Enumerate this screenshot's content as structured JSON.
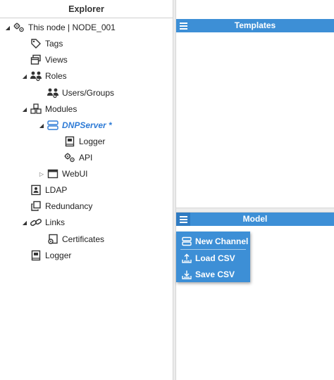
{
  "explorer": {
    "title": "Explorer",
    "nodes": [
      {
        "label": "This node | NODE_001"
      },
      {
        "label": "Tags"
      },
      {
        "label": "Views"
      },
      {
        "label": "Roles"
      },
      {
        "label": "Users/Groups"
      },
      {
        "label": "Modules"
      },
      {
        "label": "DNPServer *"
      },
      {
        "label": "Logger"
      },
      {
        "label": "API"
      },
      {
        "label": "WebUI"
      },
      {
        "label": "LDAP"
      },
      {
        "label": "Redundancy"
      },
      {
        "label": "Links"
      },
      {
        "label": "Certificates"
      },
      {
        "label": "Logger"
      }
    ]
  },
  "templates_panel": {
    "title": "Templates"
  },
  "model_panel": {
    "title": "Model"
  },
  "model_menu": {
    "items": [
      {
        "label": "New Channel",
        "icon": "server-icon"
      },
      {
        "label": "Load CSV",
        "icon": "load-icon"
      },
      {
        "label": "Save CSV",
        "icon": "save-icon"
      }
    ]
  },
  "colors": {
    "accent": "#3d8fd6",
    "selected_text": "#2e7bd6"
  }
}
